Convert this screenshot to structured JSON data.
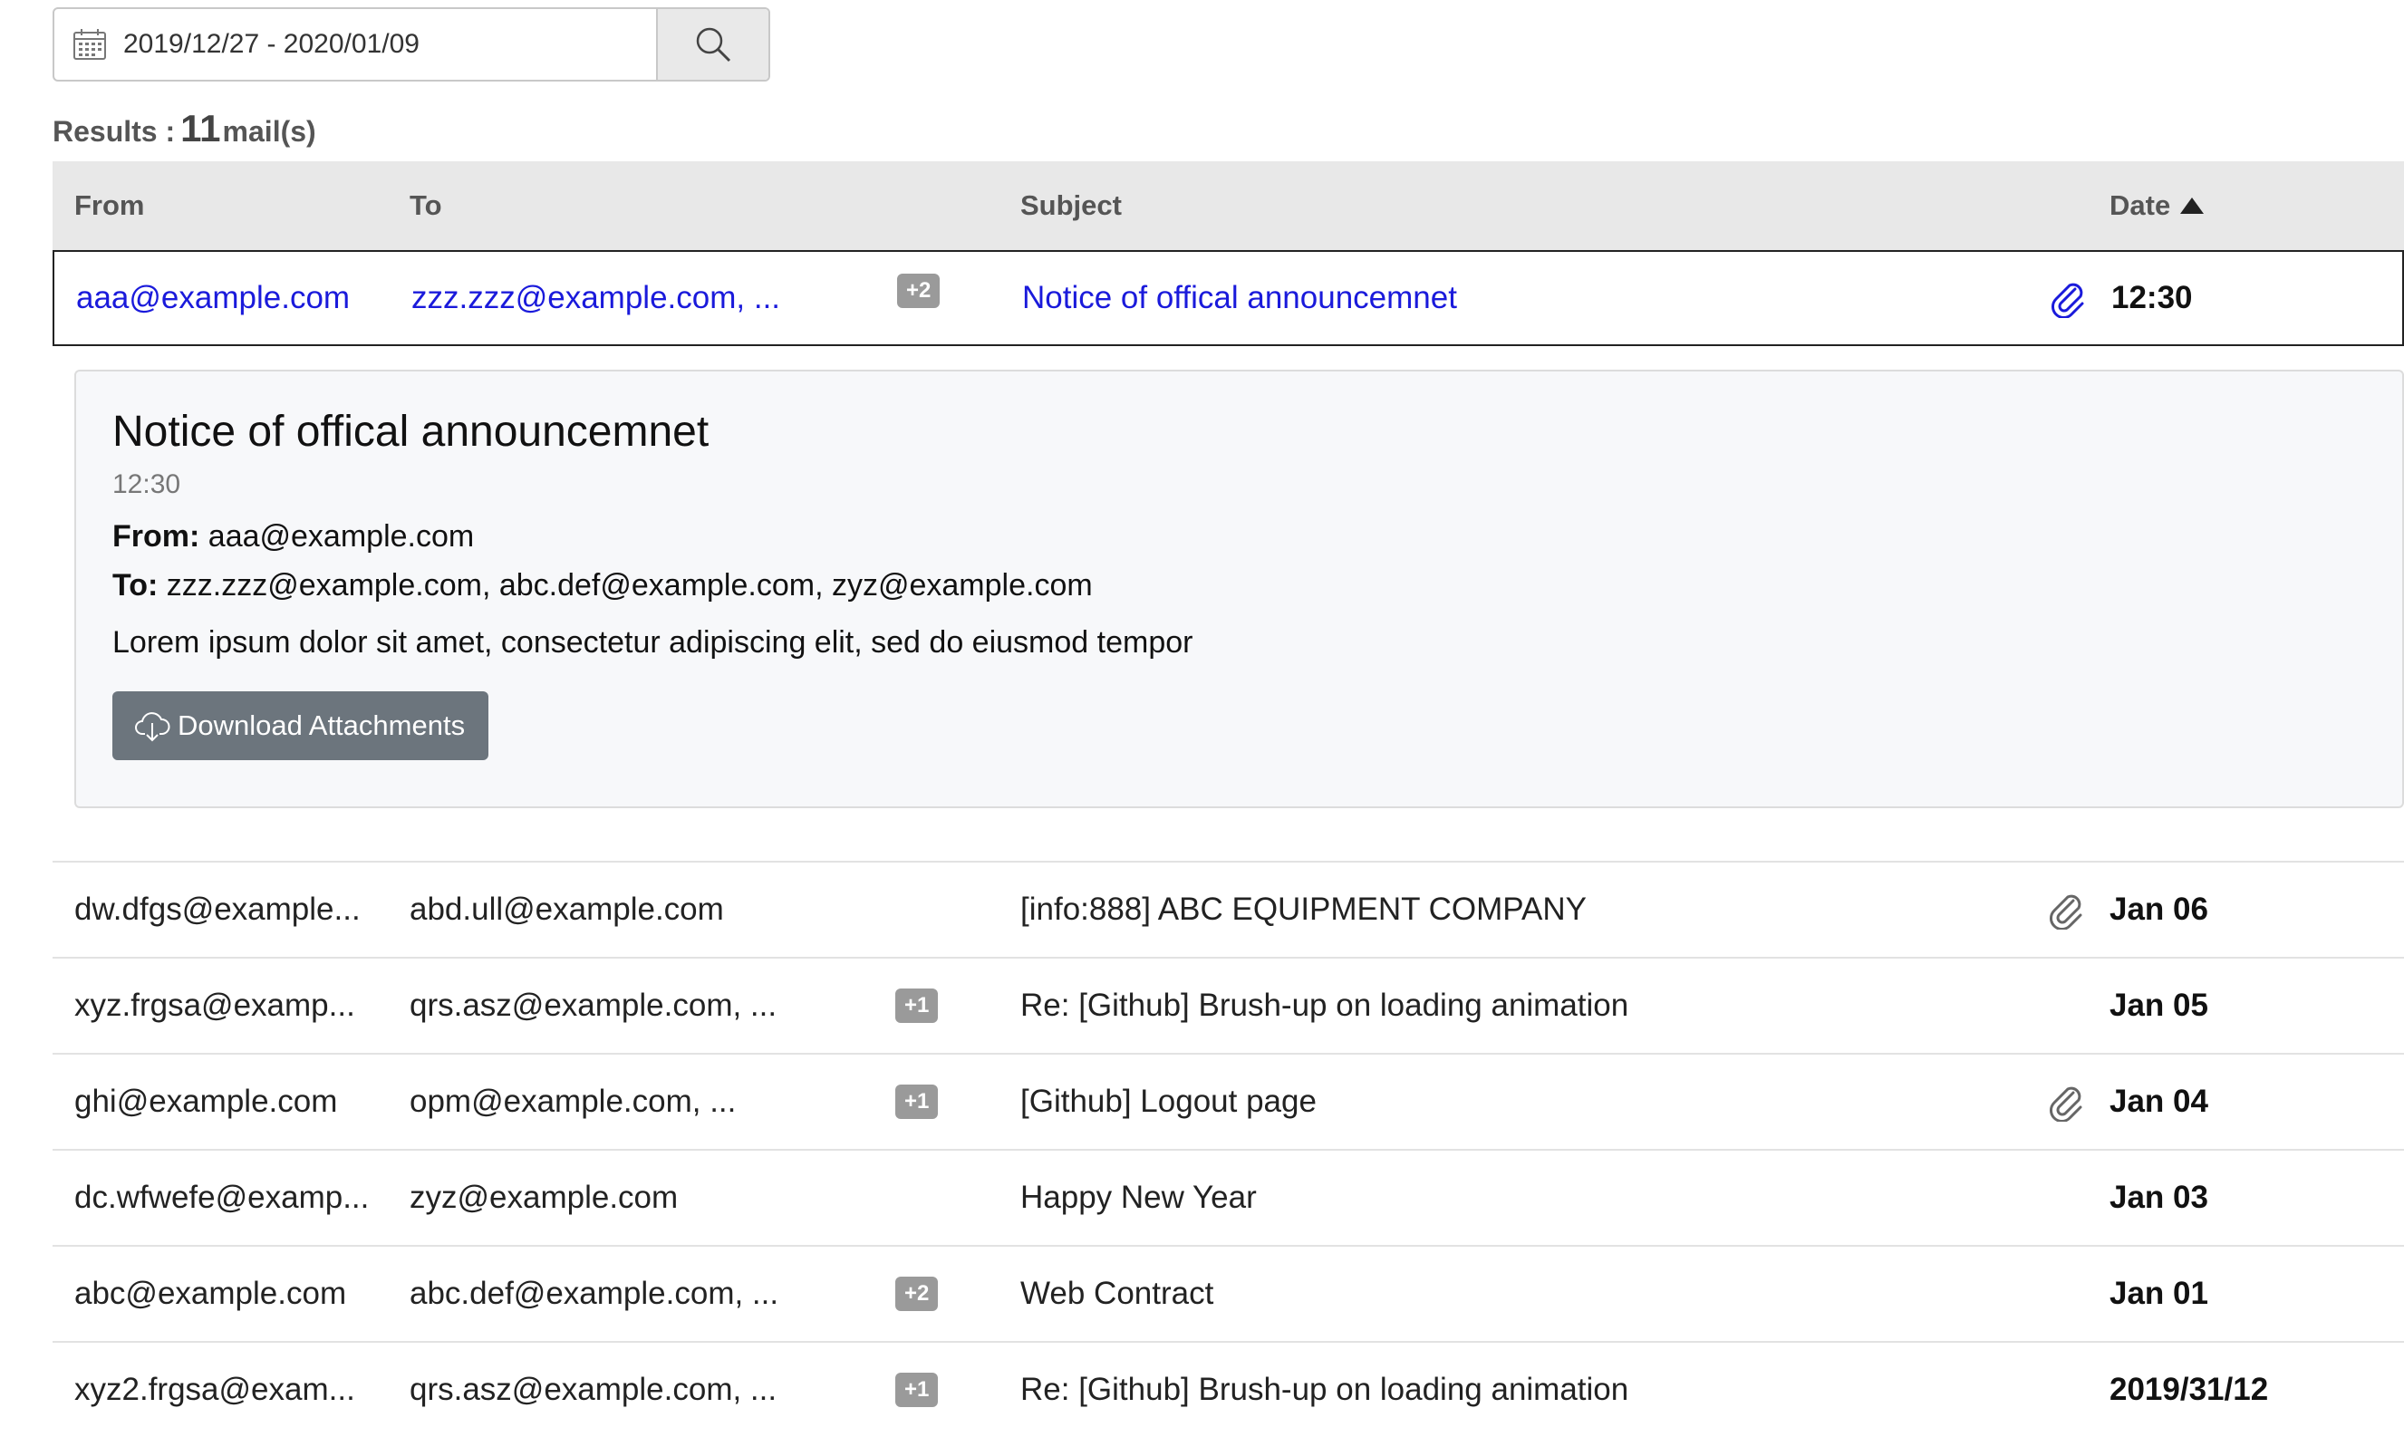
{
  "search": {
    "date_range": "2019/12/27 - 2020/01/09"
  },
  "results": {
    "label": "Results :",
    "count": "11",
    "unit": "mail(s)"
  },
  "table": {
    "headers": {
      "from": "From",
      "to": "To",
      "subject": "Subject",
      "date": "Date"
    },
    "rows": [
      {
        "from": "aaa@example.com",
        "to": "zzz.zzz@example.com, ...",
        "badge": "+2",
        "subject": "Notice of offical announcemnet",
        "attachment": true,
        "date": "12:30"
      },
      {
        "from": "dw.dfgs@example...",
        "to": "abd.ull@example.com",
        "badge": "",
        "subject": "[info:888] ABC EQUIPMENT COMPANY",
        "attachment": true,
        "date": "Jan 06"
      },
      {
        "from": "xyz.frgsa@examp...",
        "to": "qrs.asz@example.com, ...",
        "badge": "+1",
        "subject": "Re: [Github] Brush-up on loading animation",
        "attachment": false,
        "date": "Jan 05"
      },
      {
        "from": "ghi@example.com",
        "to": "opm@example.com, ...",
        "badge": "+1",
        "subject": "[Github] Logout page",
        "attachment": true,
        "date": "Jan 04"
      },
      {
        "from": "dc.wfwefe@examp...",
        "to": "zyz@example.com",
        "badge": "",
        "subject": "Happy New Year",
        "attachment": false,
        "date": "Jan 03"
      },
      {
        "from": "abc@example.com",
        "to": "abc.def@example.com, ...",
        "badge": "+2",
        "subject": "Web Contract",
        "attachment": false,
        "date": "Jan 01"
      },
      {
        "from": "xyz2.frgsa@exam...",
        "to": "qrs.asz@example.com, ...",
        "badge": "+1",
        "subject": "Re: [Github] Brush-up on loading animation",
        "attachment": false,
        "date": "2019/31/12"
      }
    ]
  },
  "detail": {
    "title": "Notice of offical announcemnet",
    "time": "12:30",
    "from_label": "From:",
    "from": "aaa@example.com",
    "to_label": "To:",
    "to": "zzz.zzz@example.com, abc.def@example.com, zyz@example.com",
    "body": "Lorem ipsum dolor sit amet, consectetur adipiscing elit, sed do eiusmod tempor",
    "download_label": "Download Attachments"
  },
  "colors": {
    "link": "#1a1adb",
    "header_bg": "#e8e8e8",
    "badge_bg": "#9a9a9a",
    "button_bg": "#6c757d",
    "detail_bg": "#f7f8fa"
  },
  "icons": {
    "date_field": "calendar-icon",
    "search_button": "search-icon",
    "sort": "sort-ascending-icon",
    "attachment": "paperclip-icon",
    "download": "cloud-download-icon"
  }
}
